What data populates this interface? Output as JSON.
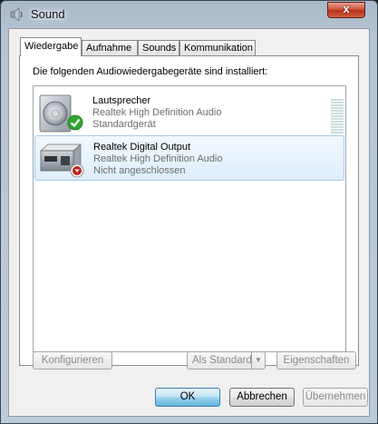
{
  "window": {
    "title": "Sound",
    "close_label": "x"
  },
  "tabs": [
    {
      "label": "Wiedergabe",
      "active": true
    },
    {
      "label": "Aufnahme",
      "active": false
    },
    {
      "label": "Sounds",
      "active": false
    },
    {
      "label": "Kommunikation",
      "active": false
    }
  ],
  "panel": {
    "intro": "Die folgenden Audiowiedergabegeräte sind installiert:"
  },
  "devices": [
    {
      "name": "Lautsprecher",
      "driver": "Realtek High Definition Audio",
      "status": "Standardgerät",
      "icon": "speaker-icon",
      "badge": "green-check-icon",
      "selected": false
    },
    {
      "name": "Realtek Digital Output",
      "driver": "Realtek High Definition Audio",
      "status": "Nicht angeschlossen",
      "icon": "digital-output-icon",
      "badge": "red-down-arrow-icon",
      "selected": true
    }
  ],
  "panel_buttons": {
    "configure": "Konfigurieren",
    "set_default": "Als Standard",
    "set_default_arrow": "▼",
    "properties": "Eigenschaften"
  },
  "dialog_buttons": {
    "ok": "OK",
    "cancel": "Abbrechen",
    "apply": "Übernehmen"
  },
  "colors": {
    "check_green": "#2ea82e",
    "status_red": "#c0241c",
    "selection_border": "#a6cbe8"
  }
}
